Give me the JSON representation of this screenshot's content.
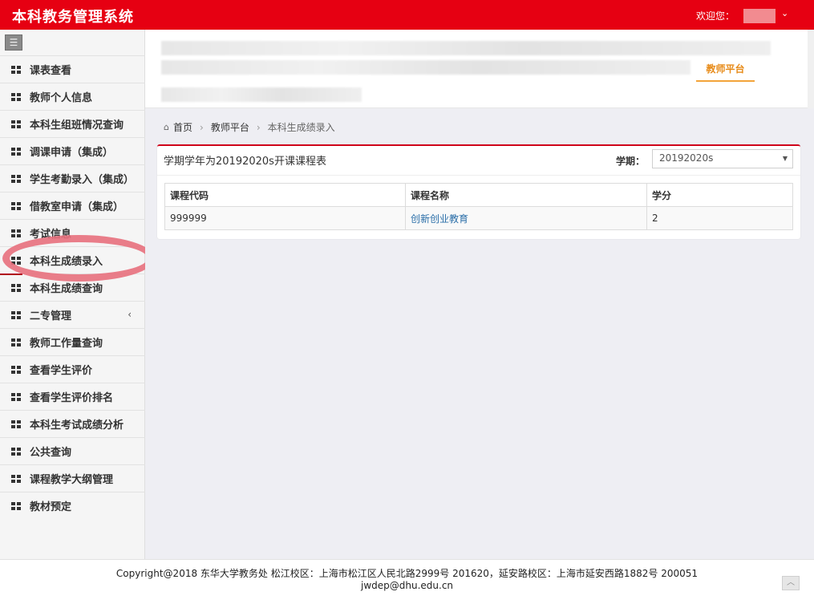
{
  "header": {
    "app_title": "本科教务管理系统",
    "welcome": "欢迎您：",
    "chevron": "⌄"
  },
  "top_nav": {
    "platform_tab": "教师平台"
  },
  "sidebar": {
    "toggle_icon": "menu-icon",
    "items": [
      {
        "label": "课表查看"
      },
      {
        "label": "教师个人信息"
      },
      {
        "label": "本科生组班情况查询"
      },
      {
        "label": "调课申请（集成）"
      },
      {
        "label": "学生考勤录入（集成）"
      },
      {
        "label": "借教室申请（集成）"
      },
      {
        "label": "考试信息"
      },
      {
        "label": "本科生成绩录入"
      },
      {
        "label": "本科生成绩查询"
      },
      {
        "label": "二专管理"
      },
      {
        "label": "教师工作量查询"
      },
      {
        "label": "查看学生评价"
      },
      {
        "label": "查看学生评价排名"
      },
      {
        "label": "本科生考试成绩分析"
      },
      {
        "label": "公共查询"
      },
      {
        "label": "课程教学大纲管理"
      },
      {
        "label": "教材预定"
      }
    ],
    "active_item": "本科生成绩录入"
  },
  "breadcrumb": {
    "home": "首页",
    "level2": "教师平台",
    "current": "本科生成绩录入"
  },
  "panel": {
    "title": "学期学年为20192020s开课课程表",
    "term_label": "学期：",
    "term_value": "20192020s"
  },
  "table": {
    "headers": [
      "课程代码",
      "课程名称",
      "学分"
    ],
    "rows": [
      [
        "999999",
        "创新创业教育",
        "2"
      ]
    ]
  },
  "footer": {
    "line1": "Copyright@2018 东华大学教务处 松江校区：上海市松江区人民北路2999号 201620，延安路校区：上海市延安西路1882号 200051",
    "line2": "jwdep@dhu.edu.cn"
  },
  "colors": {
    "brand_red": "#e60012",
    "accent_orange": "#e78a17",
    "link_blue": "#2a6ea8"
  }
}
